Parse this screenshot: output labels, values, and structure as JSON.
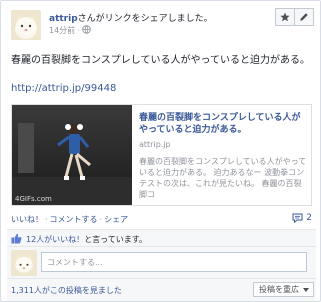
{
  "post": {
    "author": "attrip",
    "action_text": "さんがリンクをシェアしました。",
    "time": "14分前",
    "dot": "·",
    "message": "春麗の百裂脚をコンスプレしている人がやっていると迫力がある。",
    "link": "http://attrip.jp/99448"
  },
  "preview": {
    "title": "春麗の百裂脚をコンスプレしている人がやっていると迫力がある。",
    "domain": "attrip.jp",
    "description": "春麗の百裂脚をコンスプレしている人がやっていると迫力がある。 迫力あるなー 波動拳コンテストの次は、これが見たいね。 春麗の百裂脚コ",
    "watermark": "4GIFs.com"
  },
  "actions": {
    "like": "いいね！",
    "comment": "コメントする",
    "share": "シェア",
    "separator": "·",
    "comment_count": "2"
  },
  "likes": {
    "count_link": "12人がいいね！",
    "suffix": "と言っています。"
  },
  "comment_box": {
    "placeholder": "コメントする..."
  },
  "footer": {
    "views": "1,311人がこの投稿を見ました",
    "sort": "投稿を重広"
  },
  "colors": {
    "link": "#3b5998",
    "muted": "#90949c",
    "text": "#1d2129"
  },
  "icons": [
    "star-icon",
    "pencil-icon",
    "globe-icon",
    "comment-bubble-icon",
    "thumbs-up-icon",
    "caret-down-icon"
  ]
}
